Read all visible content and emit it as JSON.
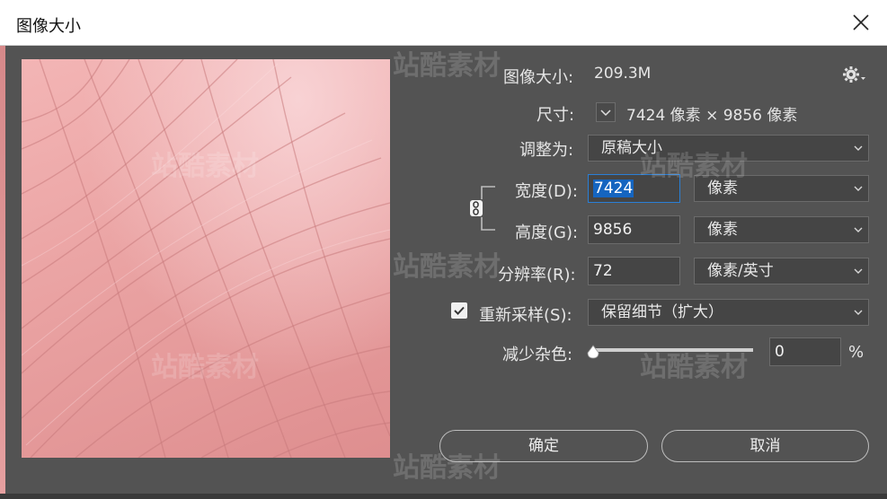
{
  "window": {
    "title": "图像大小"
  },
  "info": {
    "image_size_label": "图像大小:",
    "image_size_value": "209.3M",
    "dimensions_label": "尺寸:",
    "dimensions_value": "7424 像素  ×  9856 像素"
  },
  "fit": {
    "label": "调整为:",
    "selected": "原稿大小"
  },
  "width": {
    "label": "宽度(D):",
    "value": "7424",
    "unit": "像素"
  },
  "height": {
    "label": "高度(G):",
    "value": "9856",
    "unit": "像素"
  },
  "resolution": {
    "label": "分辨率(R):",
    "value": "72",
    "unit": "像素/英寸"
  },
  "resample": {
    "label": "重新采样(S):",
    "checked": true,
    "selected": "保留细节（扩大）"
  },
  "noise": {
    "label": "减少杂色:",
    "value": "0",
    "unit": "%"
  },
  "buttons": {
    "ok": "确定",
    "cancel": "取消"
  },
  "watermark": "站酷素材",
  "icons": {
    "close": "close-icon",
    "settings": "gear-icon",
    "link": "link-icon",
    "check": "check-icon",
    "caret": "chevron-down-icon"
  }
}
